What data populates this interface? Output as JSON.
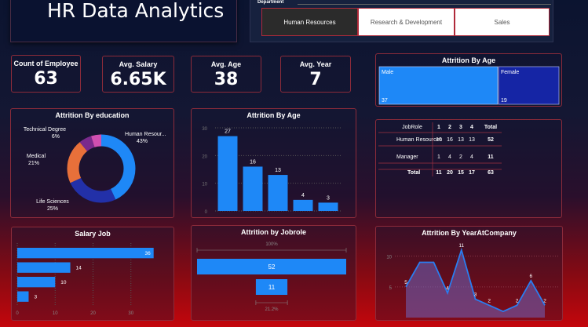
{
  "header": {
    "title": "HR Data Analytics"
  },
  "slicer": {
    "title": "Department",
    "options": [
      "Human Resources",
      "Research & Development",
      "Sales"
    ],
    "selected": "Human Resources"
  },
  "kpis": [
    {
      "label": "Count of Employee",
      "value": "63"
    },
    {
      "label": "Avg. Salary",
      "value": "6.65K"
    },
    {
      "label": "Avg. Age",
      "value": "38"
    },
    {
      "label": "Avg. Year",
      "value": "7"
    }
  ],
  "colors": {
    "accent": "#1e88f7",
    "donut": [
      "#1e88f7",
      "#2230a8",
      "#e8703a",
      "#7a2a8c",
      "#d04fb0"
    ],
    "tile_male": "#1e88f7",
    "tile_female": "#1525a5"
  },
  "chart_data": [
    {
      "id": "attrition_gender_tiles",
      "type": "treemap",
      "title": "Attrition By Age",
      "categories": [
        "Male",
        "Female"
      ],
      "values": [
        37,
        19
      ]
    },
    {
      "id": "attrition_education",
      "type": "pie",
      "title": "Attrition By education",
      "categories": [
        "Human Resour...",
        "Life Sciences",
        "Medical",
        "Technical Degree",
        "Other"
      ],
      "percent_labels": [
        "43%",
        "25%",
        "21%",
        "6%",
        ""
      ],
      "values": [
        43,
        25,
        21,
        6,
        5
      ]
    },
    {
      "id": "attrition_age",
      "type": "bar",
      "title": "Attrition By Age",
      "categories": [
        "",
        "",
        "",
        "",
        ""
      ],
      "values": [
        27,
        16,
        13,
        4,
        3
      ],
      "ylim": [
        0,
        30
      ],
      "yticks": [
        "0",
        "10",
        "20",
        "30"
      ],
      "grid": true
    },
    {
      "id": "jobrole_matrix",
      "type": "table",
      "columns": [
        "JobRole",
        "1",
        "2",
        "3",
        "4",
        "Total"
      ],
      "rows": [
        [
          "Human Resources",
          "10",
          "16",
          "13",
          "13",
          "52"
        ],
        [
          "Manager",
          "1",
          "4",
          "2",
          "4",
          "11"
        ],
        [
          "Total",
          "11",
          "20",
          "15",
          "17",
          "63"
        ]
      ]
    },
    {
      "id": "salary_job",
      "type": "bar",
      "orientation": "horizontal",
      "title": "Salary Job",
      "categories": [
        "",
        "",
        "",
        ""
      ],
      "values": [
        36,
        14,
        10,
        3
      ],
      "xlim": [
        0,
        40
      ],
      "xticks": [
        "0",
        "10",
        "20",
        "30"
      ]
    },
    {
      "id": "attrition_jobrole",
      "type": "funnel",
      "title": "Attrition by Jobrole",
      "values": [
        52,
        11
      ],
      "top_percent": "100%",
      "bottom_percent": "21.2%"
    },
    {
      "id": "attrition_year",
      "type": "area",
      "title": "Attrition By YearAtCompany",
      "values": [
        5,
        9,
        9,
        4,
        11,
        3,
        2,
        1,
        2,
        6,
        2
      ],
      "point_labels": [
        "5",
        "",
        "",
        "4",
        "11",
        "3",
        "2",
        "",
        "2",
        "6",
        "2"
      ],
      "ylim": [
        0,
        12
      ],
      "yticks": [
        "5",
        "10"
      ],
      "grid": true
    }
  ]
}
